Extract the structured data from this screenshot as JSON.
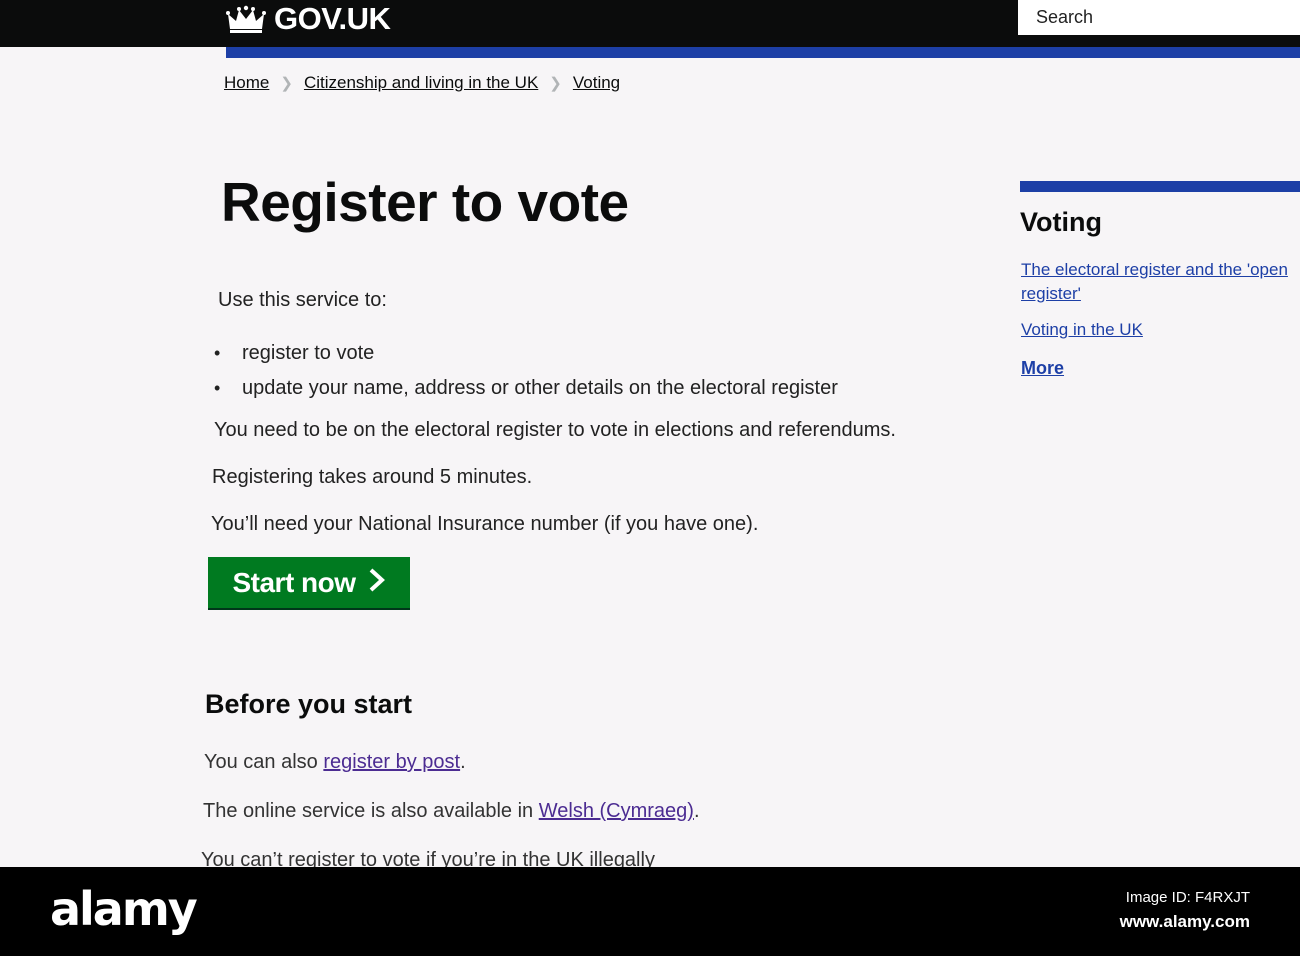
{
  "header": {
    "logo_text": "GOV.UK",
    "search_placeholder": "Search"
  },
  "breadcrumb": [
    "Home",
    "Citizenship and living in the UK",
    "Voting"
  ],
  "main": {
    "title": "Register to vote",
    "intro": "Use this service to:",
    "bullets": [
      "register to vote",
      "update your name, address or other details on the electoral register"
    ],
    "paragraphs": [
      "You need to be on the electoral register to vote in elections and referendums.",
      "Registering takes around 5 minutes.",
      "You’ll need your National Insurance number (if you have one)."
    ],
    "start_button": "Start now",
    "before_heading": "Before you start",
    "post_prefix": "You can also ",
    "post_link": "register by post",
    "post_suffix": ".",
    "welsh_prefix": "The online service is also available in ",
    "welsh_link": "Welsh (Cymraeg)",
    "welsh_suffix": ".",
    "illegal_text": "You can’t register to vote if you’re in the UK illegally"
  },
  "sidebar": {
    "title": "Voting",
    "links": [
      "The electoral register and the 'open register'",
      "Voting in the UK"
    ],
    "more": "More"
  },
  "watermark": {
    "brand": "alamy",
    "image_id": "Image ID: F4RXJT",
    "url": "www.alamy.com"
  },
  "colors": {
    "header_bg": "#0b0c0c",
    "stripe_blue": "#1d3fa6",
    "button_green": "#007a20",
    "visited_purple": "#4c2c92"
  }
}
